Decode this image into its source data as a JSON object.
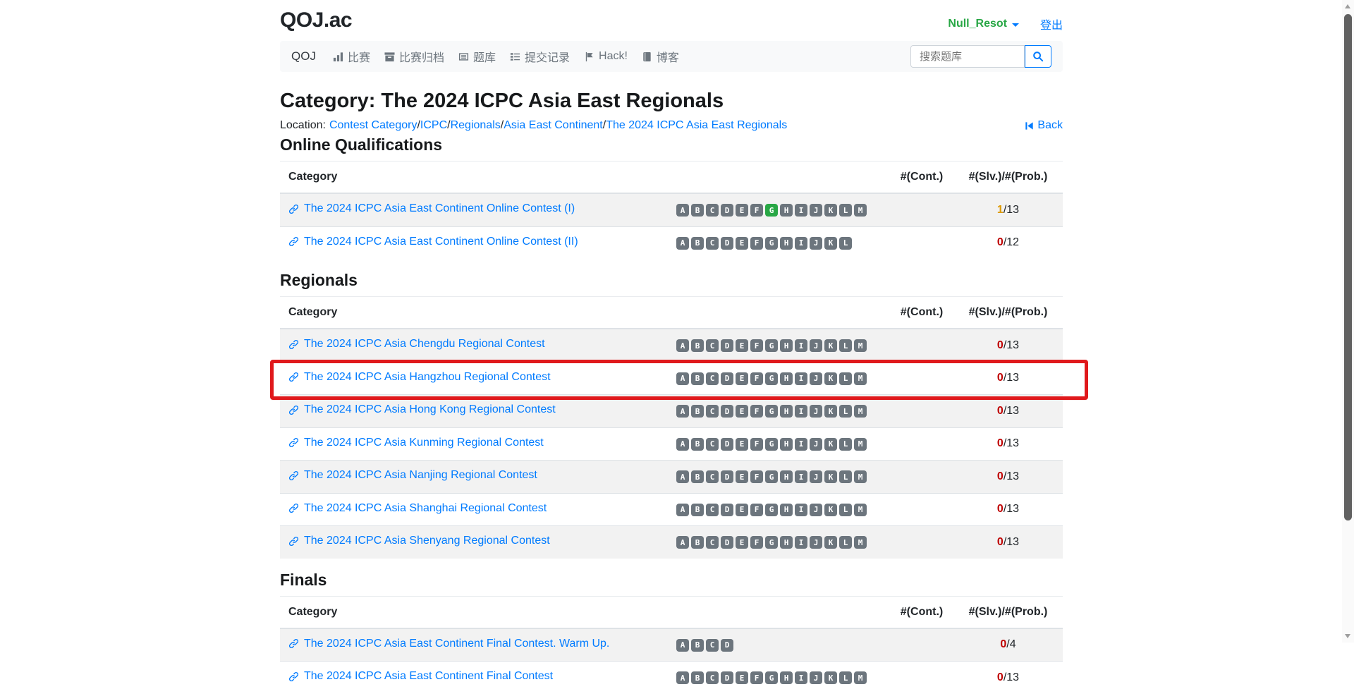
{
  "header": {
    "logo": "QOJ.ac",
    "username": "Null_Resot",
    "logout_label": "登出"
  },
  "navbar": {
    "brand": "QOJ",
    "items": [
      {
        "label": "比赛",
        "icon": "bar-chart-icon"
      },
      {
        "label": "比赛归档",
        "icon": "archive-icon"
      },
      {
        "label": "题库",
        "icon": "list-alt-icon"
      },
      {
        "label": "提交记录",
        "icon": "tasks-icon"
      },
      {
        "label": "Hack!",
        "icon": "flag-icon"
      },
      {
        "label": "博客",
        "icon": "book-icon"
      }
    ],
    "search_placeholder": "搜索题库"
  },
  "page": {
    "title": "Category: The 2024 ICPC Asia East Regionals",
    "location_label": "Location:",
    "separator": "/",
    "breadcrumb": [
      "Contest Category",
      "ICPC",
      "Regionals",
      "Asia East Continent",
      "The 2024 ICPC Asia East Regionals"
    ],
    "back_label": "Back"
  },
  "table_headers": {
    "category": "Category",
    "cont": "#(Cont.)",
    "slv": "#(Slv.)/#(Prob.)"
  },
  "sections": [
    {
      "heading": "Online Qualifications",
      "rows": [
        {
          "name": "The 2024 ICPC Asia East Continent Online Contest (I)",
          "badges": "ABCDEFGHIJKLM",
          "solved_badges": "G",
          "num": "1",
          "den": "/13",
          "num_class": "num-partial"
        },
        {
          "name": "The 2024 ICPC Asia East Continent Online Contest (II)",
          "badges": "ABCDEFGHIJKL",
          "solved_badges": "",
          "num": "0",
          "den": "/12",
          "num_class": "num-zero"
        }
      ]
    },
    {
      "heading": "Regionals",
      "rows": [
        {
          "name": "The 2024 ICPC Asia Chengdu Regional Contest",
          "badges": "ABCDEFGHIJKLM",
          "solved_badges": "",
          "num": "0",
          "den": "/13",
          "num_class": "num-zero"
        },
        {
          "name": "The 2024 ICPC Asia Hangzhou Regional Contest",
          "badges": "ABCDEFGHIJKLM",
          "solved_badges": "",
          "num": "0",
          "den": "/13",
          "num_class": "num-zero",
          "highlighted": true
        },
        {
          "name": "The 2024 ICPC Asia Hong Kong Regional Contest",
          "badges": "ABCDEFGHIJKLM",
          "solved_badges": "",
          "num": "0",
          "den": "/13",
          "num_class": "num-zero"
        },
        {
          "name": "The 2024 ICPC Asia Kunming Regional Contest",
          "badges": "ABCDEFGHIJKLM",
          "solved_badges": "",
          "num": "0",
          "den": "/13",
          "num_class": "num-zero"
        },
        {
          "name": "The 2024 ICPC Asia Nanjing Regional Contest",
          "badges": "ABCDEFGHIJKLM",
          "solved_badges": "",
          "num": "0",
          "den": "/13",
          "num_class": "num-zero"
        },
        {
          "name": "The 2024 ICPC Asia Shanghai Regional Contest",
          "badges": "ABCDEFGHIJKLM",
          "solved_badges": "",
          "num": "0",
          "den": "/13",
          "num_class": "num-zero"
        },
        {
          "name": "The 2024 ICPC Asia Shenyang Regional Contest",
          "badges": "ABCDEFGHIJKLM",
          "solved_badges": "",
          "num": "0",
          "den": "/13",
          "num_class": "num-zero"
        }
      ]
    },
    {
      "heading": "Finals",
      "rows": [
        {
          "name": "The 2024 ICPC Asia East Continent Final Contest. Warm Up.",
          "badges": "ABCD",
          "solved_badges": "",
          "num": "0",
          "den": "/4",
          "num_class": "num-zero"
        },
        {
          "name": "The 2024 ICPC Asia East Continent Final Contest",
          "badges": "ABCDEFGHIJKLM",
          "solved_badges": "",
          "num": "0",
          "den": "/13",
          "num_class": "num-zero"
        }
      ]
    }
  ],
  "colors": {
    "accent": "#007bff",
    "username_green": "#28a745",
    "badge_gray": "#6c757d",
    "badge_solved": "#28a745",
    "score_zero": "#be0000",
    "score_partial": "#dd9900",
    "highlight_red": "#e0191c"
  }
}
